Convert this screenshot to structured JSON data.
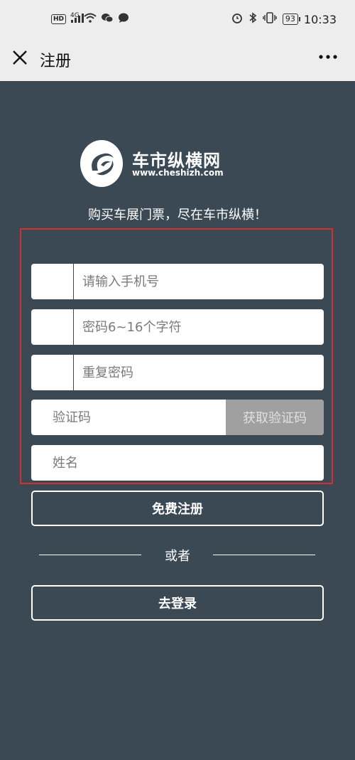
{
  "status_bar": {
    "hd": "HD",
    "network": "4G",
    "battery": "93",
    "time": "10:33"
  },
  "title_bar": {
    "title": "注册"
  },
  "brand": {
    "name": "车市纵横网",
    "url": "www.cheshizh.com"
  },
  "tagline": "购买车展门票，尽在车市纵横！",
  "form": {
    "phone_placeholder": "请输入手机号",
    "password_placeholder": "密码6~16个字符",
    "repeat_password_placeholder": "重复密码",
    "code_placeholder": "验证码",
    "get_code_label": "获取验证码",
    "name_placeholder": "姓名"
  },
  "buttons": {
    "register_label": "免费注册",
    "or_label": "或者",
    "login_label": "去登录"
  },
  "colors": {
    "background": "#3b4955",
    "highlight_border": "#d32f2f",
    "disabled_button": "#a0a0a0"
  }
}
